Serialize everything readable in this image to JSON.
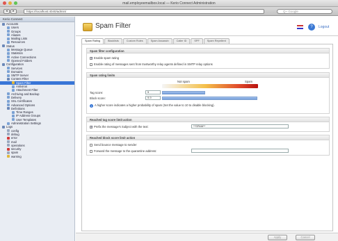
{
  "window": {
    "title": "mail.employeemailbox.local — Kerio Connect Administration"
  },
  "toolbar": {
    "back": "◂",
    "forward": "▸",
    "url": "https://localhost:4040/admin/",
    "search_placeholder": "Q~ Google"
  },
  "sidebar": {
    "header": "Kerio Connect",
    "items": [
      {
        "label": "Accounts",
        "color": "#6b88b8"
      },
      {
        "label": "Users",
        "color": "#7ba2d4"
      },
      {
        "label": "Groups",
        "color": "#7ba2d4"
      },
      {
        "label": "Aliases",
        "color": "#7ba2d4"
      },
      {
        "label": "Mailing Lists",
        "color": "#7ba2d4"
      },
      {
        "label": "Resources",
        "color": "#7ba2d4"
      },
      {
        "label": "Status",
        "color": "#6b88b8"
      },
      {
        "label": "Message Queue",
        "color": "#7ba2d4"
      },
      {
        "label": "Statistics",
        "color": "#7ba2d4"
      },
      {
        "label": "Active Connections",
        "color": "#7ba2d4"
      },
      {
        "label": "Opened Folders",
        "color": "#7ba2d4"
      },
      {
        "label": "Configuration",
        "color": "#6b88b8"
      },
      {
        "label": "Services",
        "color": "#7ba2d4"
      },
      {
        "label": "Domains",
        "color": "#7ba2d4"
      },
      {
        "label": "SMTP Server",
        "color": "#7ba2d4"
      },
      {
        "label": "Content Filter",
        "color": "#6b88b8"
      },
      {
        "label": "Spam Filter",
        "color": "#e0b83a"
      },
      {
        "label": "Antivirus",
        "color": "#7ba2d4"
      },
      {
        "label": "Attachment Filter",
        "color": "#7ba2d4"
      },
      {
        "label": "Archiving and Backup",
        "color": "#7ba2d4"
      },
      {
        "label": "Delivery",
        "color": "#7ba2d4"
      },
      {
        "label": "SSL Certificates",
        "color": "#7ba2d4"
      },
      {
        "label": "Advanced Options",
        "color": "#7ba2d4"
      },
      {
        "label": "Definitions",
        "color": "#6b88b8"
      },
      {
        "label": "Time Ranges",
        "color": "#7ba2d4"
      },
      {
        "label": "IP Address Groups",
        "color": "#7ba2d4"
      },
      {
        "label": "User Templates",
        "color": "#7ba2d4"
      },
      {
        "label": "Administration Settings",
        "color": "#7ba2d4"
      },
      {
        "label": "Logs",
        "color": "#6b88b8"
      },
      {
        "label": "config",
        "color": "#9aa8bf"
      },
      {
        "label": "debug",
        "color": "#9aa8bf"
      },
      {
        "label": "error",
        "color": "#d23a3a"
      },
      {
        "label": "mail",
        "color": "#9aa8bf"
      },
      {
        "label": "operations",
        "color": "#9aa8bf"
      },
      {
        "label": "security",
        "color": "#d23a3a"
      },
      {
        "label": "spam",
        "color": "#9aa8bf"
      },
      {
        "label": "warning",
        "color": "#e0b83a"
      }
    ]
  },
  "page": {
    "title": "Spam Filter",
    "help_link": "Logout"
  },
  "tabs": [
    "Spam Rating",
    "Blacklists",
    "Custom Rules",
    "Spam Assassin",
    "Caller ID",
    "SPF",
    "Spam Repellent"
  ],
  "config": {
    "title": "Spam filter configuration",
    "enable_rating": "Enable spam rating",
    "enable_authenticated": "Enable rating of messages sent from trustworthy relay agents defined in SMTP relay options"
  },
  "limits": {
    "title": "Spam rating limits",
    "not_spam": "Not spam",
    "spam": "Spam",
    "tag_label": "Tag score:",
    "tag_value": "5",
    "tag_level": 0.45,
    "block_label": "Block score:",
    "block_value": "9.9",
    "block_level": 0.99,
    "info": "A higher score indicates a higher probability of spam (Set the value to 10 to disable blocking)."
  },
  "tag_action": {
    "title": "Reached tag score limit action",
    "prefix_label": "Prefix the message's Subject with the text:",
    "prefix_value": "**SPAM**"
  },
  "block_action": {
    "title": "Reached block score limit action",
    "send_bounce": "Send bounce message to sender",
    "forward": "Forward the message to the quarantine address:"
  },
  "footer": {
    "apply": "Apply",
    "cancel": "Cancel"
  }
}
